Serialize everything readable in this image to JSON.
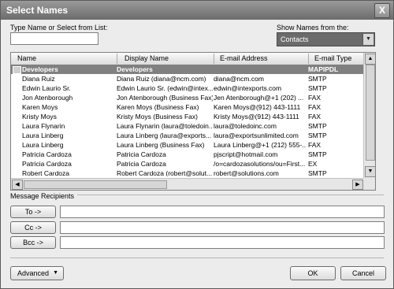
{
  "window": {
    "title": "Select Names",
    "close_label": "X"
  },
  "search": {
    "label": "Type Name or Select from List:",
    "value": ""
  },
  "source": {
    "label": "Show Names from the:",
    "selected": "Contacts"
  },
  "columns": [
    "Name",
    "Display Name",
    "E-mail Address",
    "E-mail Type"
  ],
  "entries": [
    {
      "name": "Developers",
      "display": "Developers",
      "email": "",
      "type": "MAPIPDL",
      "selected": true
    },
    {
      "name": "Diana Ruiz",
      "display": "Diana Ruiz (diana@ncm.com)",
      "email": "diana@ncm.com",
      "type": "SMTP"
    },
    {
      "name": "Edwin Laurio Sr.",
      "display": "Edwin Laurio Sr. (edwin@intex...",
      "email": "edwin@intexports.com",
      "type": "SMTP"
    },
    {
      "name": "Jon Atenborough",
      "display": "Jon Atenborough (Business Fax)",
      "email": "Jen Atenborough@+1 (202) ...",
      "type": "FAX"
    },
    {
      "name": "Karen Moys",
      "display": "Karen Moys (Business Fax)",
      "email": "Karen Moys@(912) 443-1111",
      "type": "FAX"
    },
    {
      "name": "Kristy Moys",
      "display": "Kristy Moys (Business Fax)",
      "email": "Kristy Moys@(912) 443-1111",
      "type": "FAX"
    },
    {
      "name": "Laura Flynarin",
      "display": "Laura Flynarin (laura@toledoin...",
      "email": "laura@toledoinc.com",
      "type": "SMTP"
    },
    {
      "name": "Laura Linberg",
      "display": "Laura Linberg (laura@exports...",
      "email": "laura@exportsunlimited.com",
      "type": "SMTP"
    },
    {
      "name": "Laura Linberg",
      "display": "Laura Linberg (Business Fax)",
      "email": "Laura Linberg@+1 (212) 555-...",
      "type": "FAX"
    },
    {
      "name": "Patricia Cardoza",
      "display": "Patricia Cardoza",
      "email": "pjscript@hotmail.com",
      "type": "SMTP"
    },
    {
      "name": "Patricia Cardoza",
      "display": "Patricia Cardoza",
      "email": "/o=cardozasolutions/ou=First...",
      "type": "EX"
    },
    {
      "name": "Robert Cardoza",
      "display": "Robert Cardoza (robert@solut...",
      "email": "robert@solutions.com",
      "type": "SMTP"
    }
  ],
  "recipients": {
    "label": "Message Recipients",
    "to_label": "To ->",
    "cc_label": "Cc ->",
    "bcc_label": "Bcc ->"
  },
  "footer": {
    "advanced_label": "Advanced",
    "ok_label": "OK",
    "cancel_label": "Cancel"
  }
}
